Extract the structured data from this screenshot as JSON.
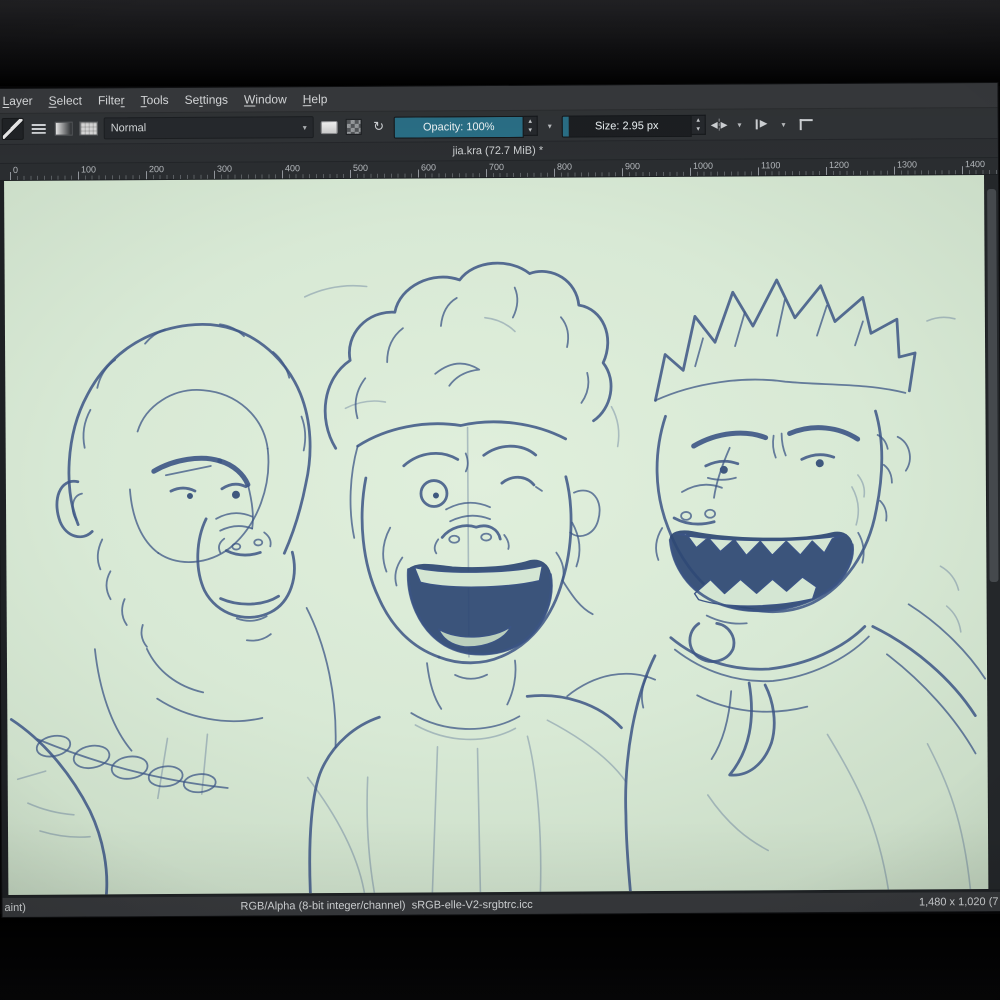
{
  "window": {
    "menu_items": [
      {
        "label": "Layer",
        "mnemonic": 0
      },
      {
        "label": "Select",
        "mnemonic": 0
      },
      {
        "label": "Filter",
        "mnemonic": 5
      },
      {
        "label": "Tools",
        "mnemonic": 0
      },
      {
        "label": "Settings",
        "mnemonic": 2
      },
      {
        "label": "Window",
        "mnemonic": 0
      },
      {
        "label": "Help",
        "mnemonic": 0
      }
    ],
    "title": "jia.kra (72.7 MiB) *"
  },
  "toolbar": {
    "blend_mode": "Normal",
    "opacity_label": "Opacity: 100%",
    "size_label": "Size: 2.95 px",
    "glyphs": {
      "reload": "↻",
      "caret": "▾",
      "spin_up": "▲",
      "spin_down": "▼",
      "mirror_left": "◀",
      "mirror_right": "▶",
      "flag": "▶"
    }
  },
  "ruler": {
    "labels": [
      "0",
      "100",
      "200",
      "300",
      "400",
      "500",
      "600",
      "700",
      "800",
      "900",
      "1000",
      "1100",
      "1200",
      "1300",
      "1400"
    ]
  },
  "statusbar": {
    "left_partial": "aint)",
    "color_info": "RGB/Alpha (8-bit integer/channel)  sRGB-elle-V2-srgbtrc.icc",
    "dimensions": "1,480 x 1,020 (7"
  },
  "canvas": {
    "paper_color": "#d8e9d5",
    "sketch_color": "#3c5585",
    "sketch_dark": "#2e4874",
    "description": "Blue pencil sketch of three laughing monkey characters"
  }
}
